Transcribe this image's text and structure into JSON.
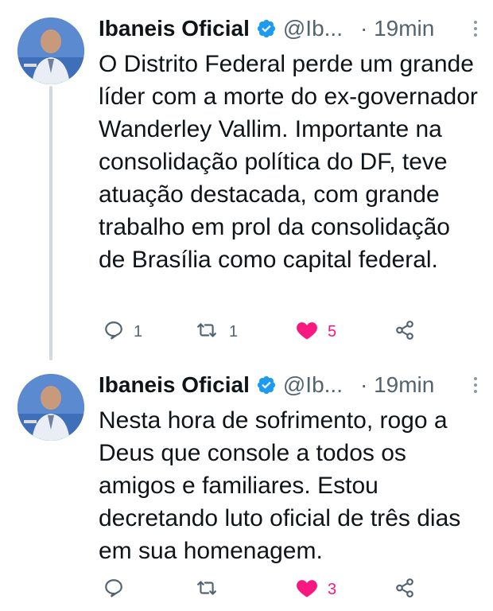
{
  "tweets": [
    {
      "name": "Ibaneis Oficial",
      "handle": "@Ib...",
      "time": "· 19min",
      "text": "O Distrito Federal perde um grande líder com a morte do ex-governador Wanderley Vallim. Importante na consolidação política do DF, teve atuação destacada, com grande trabalho em prol da consolidação de Brasília como capital federal.",
      "replies": "1",
      "retweets": "1",
      "likes": "5",
      "liked": true
    },
    {
      "name": "Ibaneis Oficial",
      "handle": "@Ib...",
      "time": "· 19min",
      "text": "Nesta hora de sofrimento, rogo a Deus que console a todos os amigos e familiares. Estou decretando luto oficial de três dias em sua homenagem.",
      "replies": "",
      "retweets": "",
      "likes": "3",
      "liked": true
    }
  ],
  "colors": {
    "verified": "#1d9bf0",
    "like": "#f91880",
    "muted": "#536471",
    "thread_line": "#cfd9de"
  },
  "icons": [
    "verified-badge-icon",
    "more-icon",
    "reply-icon",
    "retweet-icon",
    "like-icon",
    "share-icon"
  ]
}
